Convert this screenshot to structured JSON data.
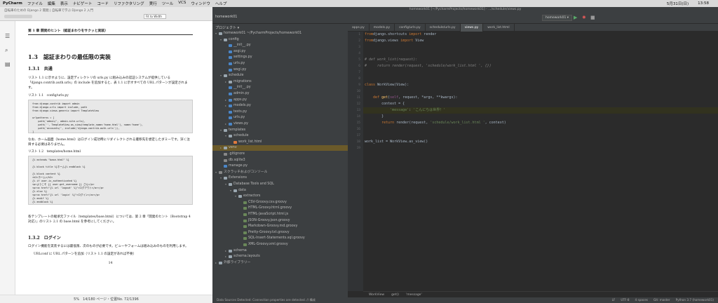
{
  "menubar": {
    "app": "PyCharm",
    "items": [
      "ファイル",
      "編集",
      "表示",
      "ナビゲート",
      "コード",
      "リファクタリング",
      "実行",
      "ツール",
      "VCS",
      "ウィンドウ",
      "ヘルプ"
    ],
    "date": "5月31日(日)",
    "time": "13:58"
  },
  "reader": {
    "title": "自転車のための Django 2 開発 | 自転車で学ぶ Django 2 入門",
    "zoom": "Fit to Width",
    "header": "第 1 章 開発のヒント（認証まわりをサクッと実装）",
    "section": "1.3　認証まわりの最低限の実装",
    "subsection": "1.3.1　共通",
    "para1": "リスト 1.1 に示すように、設定ディレクトリの urls.py に組み込みの認証システムが提供している「django.contrib.auth.urls」の include を追加すると、表 1.1 に示すすべての URL パターンが設定されます。",
    "listing1": "リスト 1.1　config/urls.py",
    "code1": "from django.contrib import admin\nfrom django.urls import include, path\nfrom django.views.generic import TemplateView\n\nurlpatterns = [\n    path('admin/', admin.site.urls),\n    path('', TemplateView.as_view(template_name='home.html'), name='home'),\n    path('accounts/', include('django.contrib.auth.urls')),\n]",
    "para2": "なお、ホーム画面（home.html）はログイン成功時にリダイレクトされる遷移先を想定したダミーです。深く注目する必要はありません。",
    "listing2": "リスト 1.2　templates/home.html",
    "code2": "{% extends \"base.html\" %}\n\n{% block title %}ホーム{% endblock %}\n\n{% block content %}\n<h2>ホーム</h2>\n{% if user.is_authenticated %}\n<p>ようこそ {{ user.get_username }} さん</p>\n<p><a href=\"{% url 'logout' %}\">ログアウト</a></p>\n{% else %}\n<p><a href=\"{% url 'login' %}\">ログイン</a></p>\n{% endif %}\n{% endblock %}",
    "para3": "各テンプレートの継承元ファイル（templates/base.html）については、第 2 章「開発のヒント（Bootstrap 4 対応）」のリスト 2.1 の base.html を参考にしてください。",
    "subsection2": "1.3.2　ログイン",
    "para4": "ログイン機能を実装するには最低限、次のものが必要です。ビューやフォームは組み込みのものを利用します。",
    "bullet": "URLconf に URL パターンを追加（リスト 1.1 の設定があれば不要）",
    "page_number": "14",
    "status": "5%　14/180 ページ・位置No. 72/1396"
  },
  "ide": {
    "window_title": "homework01 [~/PycharmProjects/homework01] - .../schedule/views.py",
    "project_crumb": "homework01",
    "project_label": "プロジェクト ▾",
    "run_config": "homework01 ▾",
    "tabs": [
      "apps.py",
      "models.py",
      "config/urls.py",
      "schedule/urls.py",
      "views.py",
      "work_list.html"
    ],
    "tree": [
      {
        "depth": 0,
        "label": "homework01  ~/PycharmProjects/homework01",
        "icon": "folder",
        "toggle": "▾"
      },
      {
        "depth": 1,
        "label": "config",
        "icon": "folder",
        "toggle": "▾"
      },
      {
        "depth": 2,
        "label": "__init__.py",
        "icon": "py",
        "toggle": ""
      },
      {
        "depth": 2,
        "label": "asgi.py",
        "icon": "py",
        "toggle": ""
      },
      {
        "depth": 2,
        "label": "settings.py",
        "icon": "py",
        "toggle": ""
      },
      {
        "depth": 2,
        "label": "urls.py",
        "icon": "py",
        "toggle": ""
      },
      {
        "depth": 2,
        "label": "wsgi.py",
        "icon": "py",
        "toggle": ""
      },
      {
        "depth": 1,
        "label": "schedule",
        "icon": "folder",
        "toggle": "▾"
      },
      {
        "depth": 2,
        "label": "migrations",
        "icon": "folder",
        "toggle": "▸"
      },
      {
        "depth": 2,
        "label": "__init__.py",
        "icon": "py",
        "toggle": ""
      },
      {
        "depth": 2,
        "label": "admin.py",
        "icon": "py",
        "toggle": ""
      },
      {
        "depth": 2,
        "label": "apps.py",
        "icon": "py",
        "toggle": "▸"
      },
      {
        "depth": 2,
        "label": "models.py",
        "icon": "py",
        "toggle": "▸"
      },
      {
        "depth": 2,
        "label": "tests.py",
        "icon": "py",
        "toggle": ""
      },
      {
        "depth": 2,
        "label": "urls.py",
        "icon": "py",
        "toggle": ""
      },
      {
        "depth": 2,
        "label": "views.py",
        "icon": "py",
        "toggle": "▸"
      },
      {
        "depth": 1,
        "label": "templates",
        "icon": "folder",
        "toggle": "▾"
      },
      {
        "depth": 2,
        "label": "schedule",
        "icon": "folder",
        "toggle": "▾"
      },
      {
        "depth": 3,
        "label": "work_list.html",
        "icon": "html",
        "toggle": ""
      },
      {
        "depth": 1,
        "label": "venv",
        "icon": "folder",
        "toggle": "▸",
        "selected": true
      },
      {
        "depth": 1,
        "label": ".gitignore",
        "icon": "misc",
        "toggle": ""
      },
      {
        "depth": 1,
        "label": "db.sqlite3",
        "icon": "misc",
        "toggle": ""
      },
      {
        "depth": 1,
        "label": "manage.py",
        "icon": "py",
        "toggle": ""
      },
      {
        "depth": 0,
        "label": "スクラッチおよびコンソール",
        "icon": "misc",
        "toggle": "▾"
      },
      {
        "depth": 1,
        "label": "Extensions",
        "icon": "folder",
        "toggle": "▾"
      },
      {
        "depth": 2,
        "label": "Database Tools and SQL",
        "icon": "folder",
        "toggle": "▾"
      },
      {
        "depth": 3,
        "label": "data",
        "icon": "folder",
        "toggle": "▾"
      },
      {
        "depth": 4,
        "label": "extractors",
        "icon": "folder",
        "toggle": "▾"
      },
      {
        "depth": 5,
        "label": "CSV-Groovy.csv.groovy",
        "icon": "gr",
        "toggle": ""
      },
      {
        "depth": 5,
        "label": "HTML-Groovy.html.groovy",
        "icon": "gr",
        "toggle": ""
      },
      {
        "depth": 5,
        "label": "HTML-JavaScript.html.js",
        "icon": "gr",
        "toggle": ""
      },
      {
        "depth": 5,
        "label": "JSON-Groovy.json.groovy",
        "icon": "gr",
        "toggle": ""
      },
      {
        "depth": 5,
        "label": "Markdown-Groovy.md.groovy",
        "icon": "gr",
        "toggle": ""
      },
      {
        "depth": 5,
        "label": "Pretty-Groovy.txt.groovy",
        "icon": "gr",
        "toggle": ""
      },
      {
        "depth": 5,
        "label": "SQL-Insert-Statements.sql.groovy",
        "icon": "gr",
        "toggle": ""
      },
      {
        "depth": 5,
        "label": "XML-Groovy.xml.groovy",
        "icon": "gr",
        "toggle": ""
      },
      {
        "depth": 2,
        "label": "schema",
        "icon": "folder",
        "toggle": "▸"
      },
      {
        "depth": 2,
        "label": "schema.layouts",
        "icon": "folder",
        "toggle": "▸"
      },
      {
        "depth": 0,
        "label": "外部ライブラリー",
        "icon": "folder",
        "toggle": "▸"
      }
    ],
    "code_lines": [
      [
        [
          "kw",
          "from"
        ],
        [
          "",
          "django.shortcuts "
        ],
        [
          "kw",
          "import"
        ],
        [
          "",
          " render"
        ]
      ],
      [
        [
          "kw",
          "from"
        ],
        [
          "",
          "django.views "
        ],
        [
          "kw",
          "import"
        ],
        [
          "",
          " View"
        ]
      ],
      [],
      [],
      [
        [
          "cm",
          "# def work_list(request):"
        ]
      ],
      [
        [
          "cm",
          "#     return render(request, 'schedule/work_list.html ', {})"
        ]
      ],
      [],
      [],
      [
        [
          "kw",
          "class "
        ],
        [
          "",
          "WorkView(View):"
        ]
      ],
      [],
      [
        [
          "",
          "    "
        ],
        [
          "kw",
          "def "
        ],
        [
          "fn",
          "get"
        ],
        [
          "",
          "("
        ],
        [
          "sf",
          "self"
        ],
        [
          "",
          ", request, *args, **kwargs):"
        ]
      ],
      [
        [
          "",
          "        context = {"
        ]
      ],
      [
        [
          "",
          "            "
        ],
        [
          "st",
          "'message'"
        ],
        [
          "",
          ": "
        ],
        [
          "st",
          "'こんにちは世界！'"
        ]
      ],
      [
        [
          "",
          "        }"
        ]
      ],
      [
        [
          "",
          "        "
        ],
        [
          "kw",
          "return "
        ],
        [
          "",
          "render(request, "
        ],
        [
          "st",
          "'schedule/work_list.html '"
        ],
        [
          "",
          ", context)"
        ]
      ],
      [],
      [],
      [
        [
          "",
          "work_list = WorkView.as_view()"
        ]
      ],
      []
    ],
    "highlight_line": 13,
    "breadcrumb": [
      "WorkView",
      "get()",
      "'message'"
    ],
    "status_left": "Data Sources Detected: Connection properties are detected. // 構成",
    "status_right": [
      "LF",
      "UTF-8",
      "4 spaces",
      "Git: master",
      "Python 3.7 (homework01)"
    ]
  }
}
